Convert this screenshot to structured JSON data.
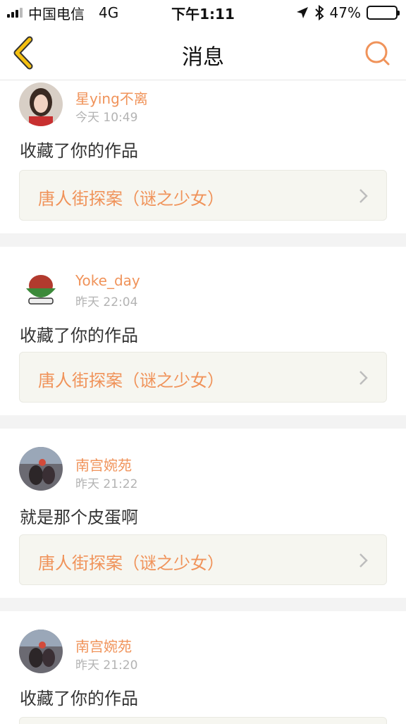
{
  "status_bar": {
    "carrier": "中国电信",
    "network": "4G",
    "time": "下午1:11",
    "battery_percent": "47%",
    "battery_level": 0.47
  },
  "nav": {
    "title": "消息",
    "back_icon": "chevron-left-icon",
    "search_icon": "search-icon",
    "accent_color": "#f0935a",
    "back_color": "#f5c010"
  },
  "messages": [
    {
      "username": "星ying不离",
      "time": "今天 10:49",
      "text": "收藏了你的作品",
      "work_title": "唐人街探案（谜之少女）"
    },
    {
      "username": "Yoke_day",
      "time": "昨天 22:04",
      "text": "收藏了你的作品",
      "work_title": "唐人街探案（谜之少女）"
    },
    {
      "username": "南宫婉苑",
      "time": "昨天 21:22",
      "text": "就是那个皮蛋啊",
      "work_title": "唐人街探案（谜之少女）"
    },
    {
      "username": "南宫婉苑",
      "time": "昨天 21:20",
      "text": "收藏了你的作品",
      "work_title": ""
    }
  ]
}
